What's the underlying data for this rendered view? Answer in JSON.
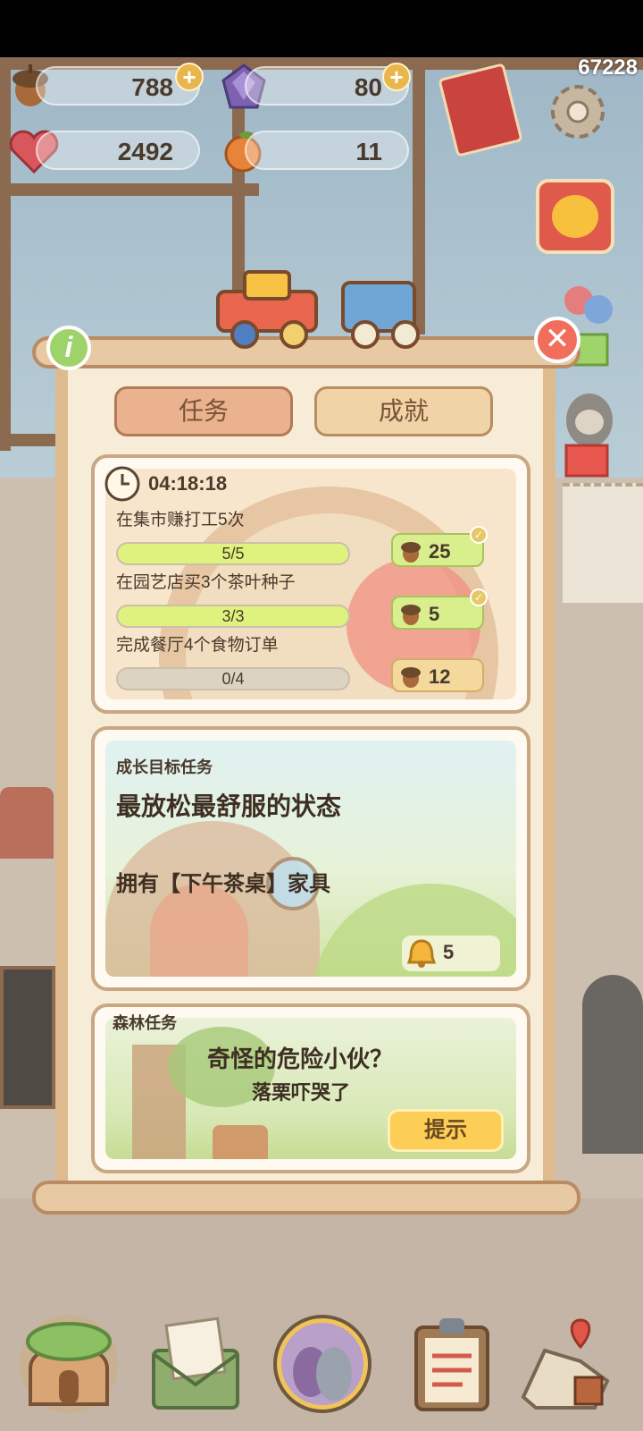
{
  "score": "67228",
  "currencies": {
    "acorns": "788",
    "gems": "80",
    "hearts": "2492",
    "oranges": "11"
  },
  "tabs": [
    {
      "label": "任务"
    },
    {
      "label": "成就"
    }
  ],
  "daily": {
    "timer": "04:18:18",
    "tasks": [
      {
        "title": "在集市赚打工5次",
        "progress": "5/5",
        "fraction": 1.0,
        "reward": "25",
        "completed": true
      },
      {
        "title": "在园艺店买3个茶叶种子",
        "progress": "3/3",
        "fraction": 1.0,
        "reward": "5",
        "completed": true
      },
      {
        "title": "完成餐厅4个食物订单",
        "progress": "0/4",
        "fraction": 0.0,
        "reward": "12",
        "completed": false
      }
    ]
  },
  "growth": {
    "header": "成长目标任务",
    "title": "最放松最舒服的状态",
    "desc": "拥有【下午茶桌】家具",
    "reward": "5"
  },
  "forest": {
    "header": "森林任务",
    "title": "奇怪的危险小伙？",
    "subtitle": "落栗吓哭了",
    "hint_label": "提示"
  },
  "colors": {
    "accent_green": "#d9ee8c",
    "tab_active": "#eab28f",
    "hint_yellow": "#fcce56",
    "close_red": "#f06e5b"
  }
}
